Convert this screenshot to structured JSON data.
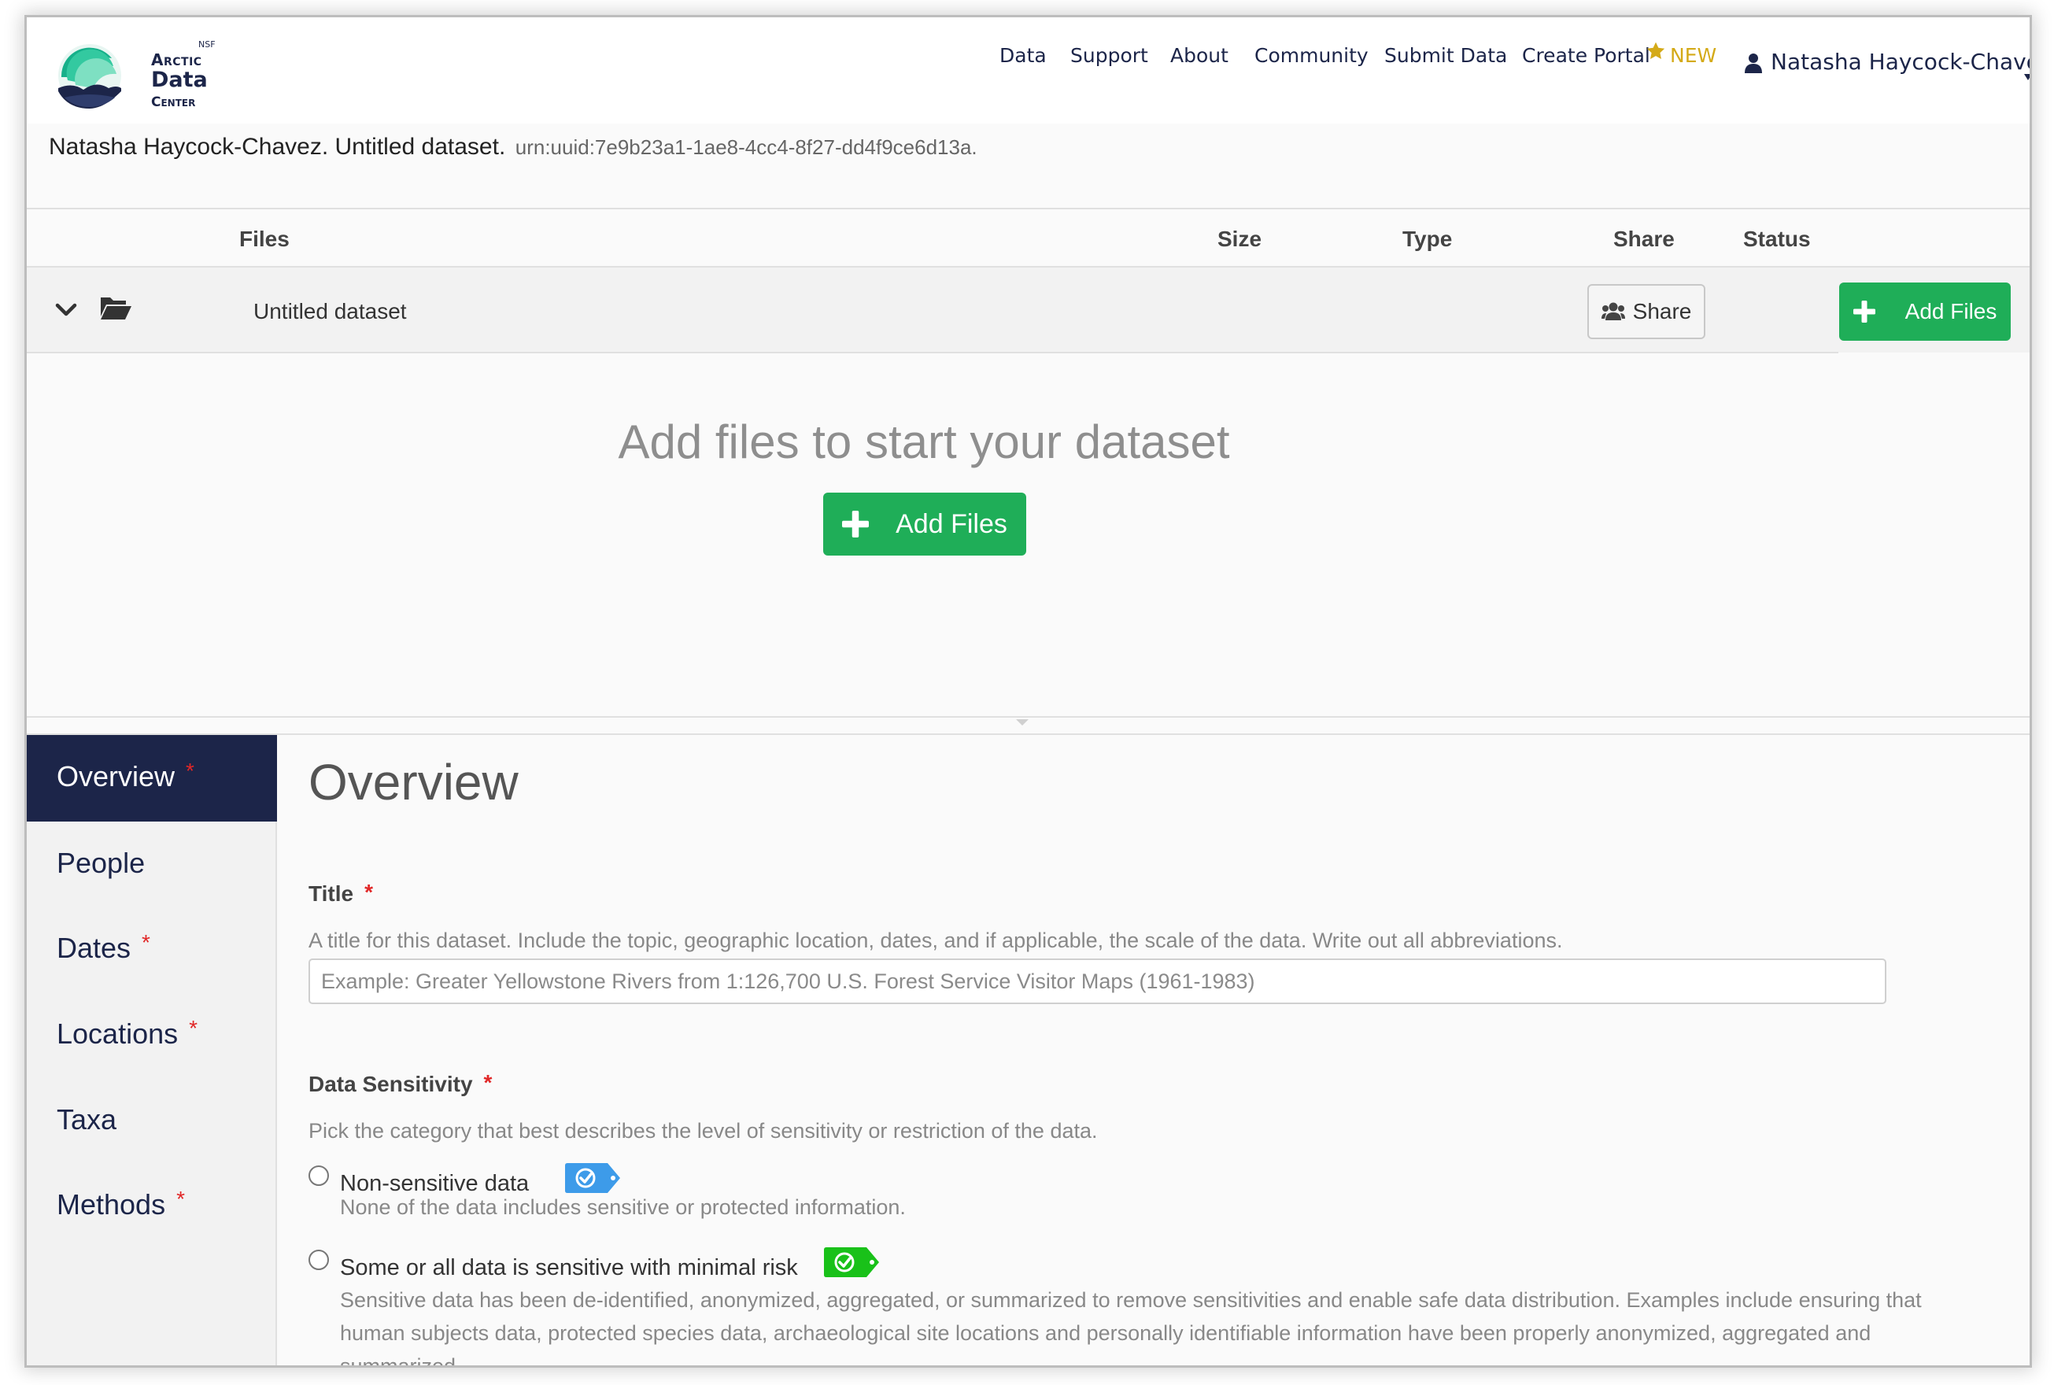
{
  "header": {
    "logo": {
      "nsf": "NSF",
      "line1": "Arctic",
      "line2": "Data",
      "line3": "Center"
    },
    "nav": [
      "Data",
      "Support",
      "About",
      "Community",
      "Submit Data",
      "Create Portal"
    ],
    "new_badge": "NEW",
    "user_name": "Natasha Haycock-Chavez"
  },
  "citation": {
    "text": "Natasha Haycock-Chavez. Untitled dataset.",
    "identifier": "urn:uuid:7e9b23a1-1ae8-4cc4-8f27-dd4f9ce6d13a."
  },
  "files_table": {
    "columns": [
      "Files",
      "Size",
      "Type",
      "Share",
      "Status"
    ],
    "rows": [
      {
        "name": "Untitled dataset",
        "share_label": "Share",
        "add_label": "Add Files"
      }
    ],
    "empty_message": "Add files to start your dataset",
    "add_files_label": "Add Files"
  },
  "sections": [
    {
      "label": "Overview",
      "required": true,
      "active": true
    },
    {
      "label": "People",
      "required": false
    },
    {
      "label": "Dates",
      "required": true
    },
    {
      "label": "Locations",
      "required": true
    },
    {
      "label": "Taxa",
      "required": false
    },
    {
      "label": "Methods",
      "required": true
    }
  ],
  "required_marker": "*",
  "overview": {
    "heading": "Overview",
    "title": {
      "label": "Title",
      "help": "A title for this dataset. Include the topic, geographic location, dates, and if applicable, the scale of the data. Write out all abbreviations.",
      "placeholder": "Example: Greater Yellowstone Rivers from 1:126,700 U.S. Forest Service Visitor Maps (1961-1983)",
      "value": ""
    },
    "sensitivity": {
      "label": "Data Sensitivity",
      "help": "Pick the category that best describes the level of sensitivity or restriction of the data.",
      "options": [
        {
          "label": "Non-sensitive data",
          "description": "None of the data includes sensitive or protected information.",
          "tag_icon": "blue-check-tag-icon",
          "tag_color": "#3d9be9"
        },
        {
          "label": "Some or all data is sensitive with minimal risk",
          "description": "Sensitive data has been de-identified, anonymized, aggregated, or summarized to remove sensitivities and enable safe data distribution. Examples include ensuring that human subjects data, protected species data, archaeological site locations and personally identifiable information have been properly anonymized, aggregated and summarized.",
          "tag_icon": "green-check-tag-icon",
          "tag_color": "#19c119"
        }
      ]
    }
  },
  "colors": {
    "navy": "#1c2549",
    "green_button": "#1fae58",
    "required": "#e12727",
    "new_badge": "#d4aa18"
  }
}
